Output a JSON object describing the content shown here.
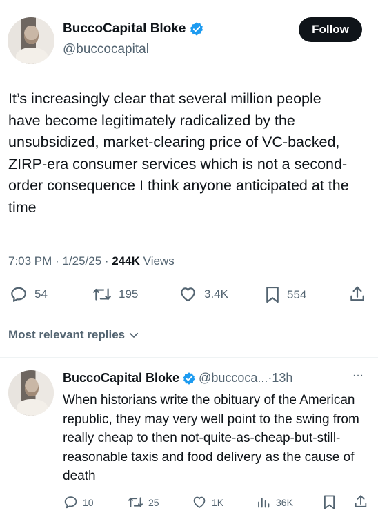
{
  "tweet": {
    "author_name": "BuccoCapital Bloke",
    "author_handle": "@buccocapital",
    "follow_label": "Follow",
    "text": "It’s increasingly clear that several million people have become legitimately radicalized by the unsubsidized, market-clearing price of VC-backed, ZIRP-era consumer services which is not a second-order consequence I think anyone anticipated at the time",
    "time": "7:03 PM",
    "date": "1/25/25",
    "views_count": "244K",
    "views_label": "Views",
    "replies": "54",
    "reposts": "195",
    "likes": "3.4K",
    "bookmarks": "554"
  },
  "replies_section": {
    "sort_label": "Most relevant replies"
  },
  "reply": {
    "author_name": "BuccoCapital Bloke",
    "author_handle": "@buccoca...",
    "age": "13h",
    "more": "···",
    "text": "When historians write the obituary of the American republic, they may very well point to the swing from really cheap to then not-quite-as-cheap-but-still-reasonable taxis and food delivery as the cause of death",
    "replies": "10",
    "reposts": "25",
    "likes": "1K",
    "views": "36K"
  },
  "colors": {
    "text_primary": "#0f1419",
    "text_secondary": "#536471",
    "verified_blue": "#1d9bf0",
    "divider": "#eff3f4"
  }
}
